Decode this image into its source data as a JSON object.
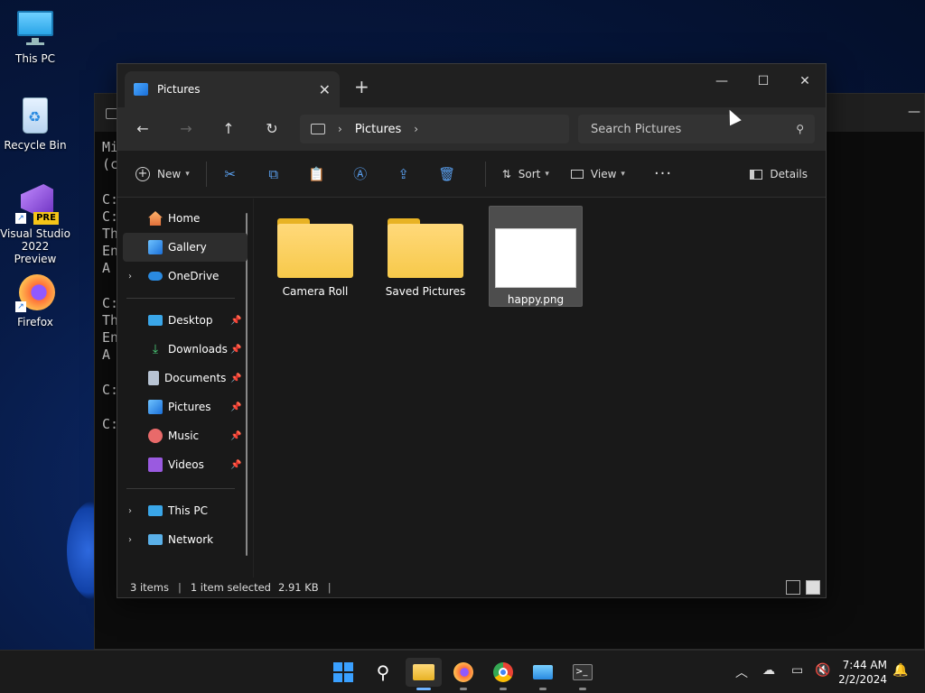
{
  "desktop": {
    "icons": [
      {
        "label": "This PC"
      },
      {
        "label": "Recycle Bin"
      },
      {
        "label": "Visual Studio 2022 Preview",
        "badge": "PRE"
      },
      {
        "label": "Firefox"
      }
    ]
  },
  "console": {
    "lines": "Mi\n(c\n\nC:\nC:\nTh\nEn\nA \n\nC:\nTh\nEn\nA \n\nC:\n\nC:"
  },
  "explorer": {
    "tab_title": "Pictures",
    "address": {
      "crumbs": [
        "Pictures"
      ]
    },
    "search_placeholder": "Search Pictures",
    "toolbar": {
      "new_label": "New",
      "sort_label": "Sort",
      "view_label": "View",
      "details_label": "Details"
    },
    "sidebar": {
      "home": "Home",
      "gallery": "Gallery",
      "onedrive": "OneDrive",
      "desktop": "Desktop",
      "downloads": "Downloads",
      "documents": "Documents",
      "pictures": "Pictures",
      "music": "Music",
      "videos": "Videos",
      "thispc": "This PC",
      "network": "Network"
    },
    "items": [
      {
        "name": "Camera Roll",
        "type": "folder"
      },
      {
        "name": "Saved Pictures",
        "type": "folder"
      },
      {
        "name": "happy.png",
        "type": "image",
        "selected": true
      }
    ],
    "status": {
      "count": "3 items",
      "selected": "1 item selected",
      "size": "2.91 KB"
    }
  },
  "taskbar": {
    "time": "7:44 AM",
    "date": "2/2/2024"
  },
  "colors": {
    "accent": "#5aa0f0",
    "folder": "#f7c94a",
    "window_bg": "#191919"
  }
}
